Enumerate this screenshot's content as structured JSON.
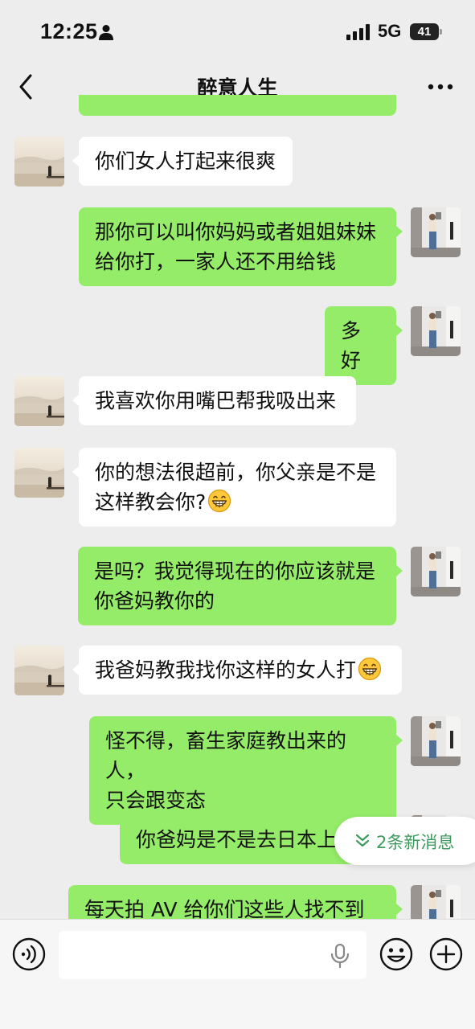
{
  "status_bar": {
    "time": "12:25",
    "network": "5G",
    "battery": "41"
  },
  "header": {
    "title": "醉意人生"
  },
  "messages": [
    {
      "side": "in",
      "text": "你们女人打起来很爽"
    },
    {
      "side": "out",
      "text": "那你可以叫你妈妈或者姐姐妹妹\n给你打，一家人还不用给钱"
    },
    {
      "side": "out",
      "text": "多好"
    },
    {
      "side": "in",
      "text": "我喜欢你用嘴巴帮我吸出来"
    },
    {
      "side": "in",
      "text": "你的想法很超前，你父亲是不是\n这样教会你?"
    },
    {
      "side": "out",
      "text": "是吗？我觉得现在的你应该就是\n你爸妈教你的"
    },
    {
      "side": "in",
      "text": "我爸妈教我找你这样的女人打"
    },
    {
      "side": "out",
      "text": "怪不得，畜生家庭教出来的人，\n只会跟变态"
    },
    {
      "side": "out",
      "text": "你爸妈是不是去日本上"
    },
    {
      "side": "out",
      "text": "每天拍 AV 给你们这些人找不到老"
    }
  ],
  "new_messages": {
    "label": "2条新消息"
  },
  "input_bar": {
    "placeholder": ""
  },
  "colors": {
    "background": "#ededed",
    "incoming_bubble": "#ffffff",
    "outgoing_bubble": "#95ec69",
    "accent": "#3f9a5e"
  },
  "icons": [
    "person-icon",
    "signal-icon",
    "battery-icon",
    "back-icon",
    "more-icon",
    "grin-emoji-icon",
    "double-chevron-down-icon",
    "voice-icon",
    "mic-icon",
    "emoji-icon",
    "plus-icon"
  ]
}
